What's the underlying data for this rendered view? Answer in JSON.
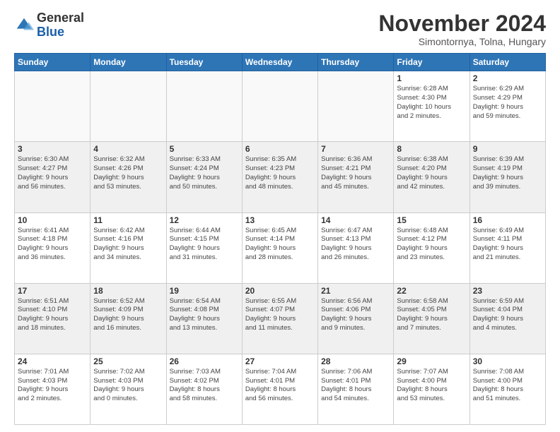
{
  "logo": {
    "general": "General",
    "blue": "Blue"
  },
  "header": {
    "month": "November 2024",
    "location": "Simontornya, Tolna, Hungary"
  },
  "weekdays": [
    "Sunday",
    "Monday",
    "Tuesday",
    "Wednesday",
    "Thursday",
    "Friday",
    "Saturday"
  ],
  "weeks": [
    [
      {
        "day": "",
        "info": ""
      },
      {
        "day": "",
        "info": ""
      },
      {
        "day": "",
        "info": ""
      },
      {
        "day": "",
        "info": ""
      },
      {
        "day": "",
        "info": ""
      },
      {
        "day": "1",
        "info": "Sunrise: 6:28 AM\nSunset: 4:30 PM\nDaylight: 10 hours\nand 2 minutes."
      },
      {
        "day": "2",
        "info": "Sunrise: 6:29 AM\nSunset: 4:29 PM\nDaylight: 9 hours\nand 59 minutes."
      }
    ],
    [
      {
        "day": "3",
        "info": "Sunrise: 6:30 AM\nSunset: 4:27 PM\nDaylight: 9 hours\nand 56 minutes."
      },
      {
        "day": "4",
        "info": "Sunrise: 6:32 AM\nSunset: 4:26 PM\nDaylight: 9 hours\nand 53 minutes."
      },
      {
        "day": "5",
        "info": "Sunrise: 6:33 AM\nSunset: 4:24 PM\nDaylight: 9 hours\nand 50 minutes."
      },
      {
        "day": "6",
        "info": "Sunrise: 6:35 AM\nSunset: 4:23 PM\nDaylight: 9 hours\nand 48 minutes."
      },
      {
        "day": "7",
        "info": "Sunrise: 6:36 AM\nSunset: 4:21 PM\nDaylight: 9 hours\nand 45 minutes."
      },
      {
        "day": "8",
        "info": "Sunrise: 6:38 AM\nSunset: 4:20 PM\nDaylight: 9 hours\nand 42 minutes."
      },
      {
        "day": "9",
        "info": "Sunrise: 6:39 AM\nSunset: 4:19 PM\nDaylight: 9 hours\nand 39 minutes."
      }
    ],
    [
      {
        "day": "10",
        "info": "Sunrise: 6:41 AM\nSunset: 4:18 PM\nDaylight: 9 hours\nand 36 minutes."
      },
      {
        "day": "11",
        "info": "Sunrise: 6:42 AM\nSunset: 4:16 PM\nDaylight: 9 hours\nand 34 minutes."
      },
      {
        "day": "12",
        "info": "Sunrise: 6:44 AM\nSunset: 4:15 PM\nDaylight: 9 hours\nand 31 minutes."
      },
      {
        "day": "13",
        "info": "Sunrise: 6:45 AM\nSunset: 4:14 PM\nDaylight: 9 hours\nand 28 minutes."
      },
      {
        "day": "14",
        "info": "Sunrise: 6:47 AM\nSunset: 4:13 PM\nDaylight: 9 hours\nand 26 minutes."
      },
      {
        "day": "15",
        "info": "Sunrise: 6:48 AM\nSunset: 4:12 PM\nDaylight: 9 hours\nand 23 minutes."
      },
      {
        "day": "16",
        "info": "Sunrise: 6:49 AM\nSunset: 4:11 PM\nDaylight: 9 hours\nand 21 minutes."
      }
    ],
    [
      {
        "day": "17",
        "info": "Sunrise: 6:51 AM\nSunset: 4:10 PM\nDaylight: 9 hours\nand 18 minutes."
      },
      {
        "day": "18",
        "info": "Sunrise: 6:52 AM\nSunset: 4:09 PM\nDaylight: 9 hours\nand 16 minutes."
      },
      {
        "day": "19",
        "info": "Sunrise: 6:54 AM\nSunset: 4:08 PM\nDaylight: 9 hours\nand 13 minutes."
      },
      {
        "day": "20",
        "info": "Sunrise: 6:55 AM\nSunset: 4:07 PM\nDaylight: 9 hours\nand 11 minutes."
      },
      {
        "day": "21",
        "info": "Sunrise: 6:56 AM\nSunset: 4:06 PM\nDaylight: 9 hours\nand 9 minutes."
      },
      {
        "day": "22",
        "info": "Sunrise: 6:58 AM\nSunset: 4:05 PM\nDaylight: 9 hours\nand 7 minutes."
      },
      {
        "day": "23",
        "info": "Sunrise: 6:59 AM\nSunset: 4:04 PM\nDaylight: 9 hours\nand 4 minutes."
      }
    ],
    [
      {
        "day": "24",
        "info": "Sunrise: 7:01 AM\nSunset: 4:03 PM\nDaylight: 9 hours\nand 2 minutes."
      },
      {
        "day": "25",
        "info": "Sunrise: 7:02 AM\nSunset: 4:03 PM\nDaylight: 9 hours\nand 0 minutes."
      },
      {
        "day": "26",
        "info": "Sunrise: 7:03 AM\nSunset: 4:02 PM\nDaylight: 8 hours\nand 58 minutes."
      },
      {
        "day": "27",
        "info": "Sunrise: 7:04 AM\nSunset: 4:01 PM\nDaylight: 8 hours\nand 56 minutes."
      },
      {
        "day": "28",
        "info": "Sunrise: 7:06 AM\nSunset: 4:01 PM\nDaylight: 8 hours\nand 54 minutes."
      },
      {
        "day": "29",
        "info": "Sunrise: 7:07 AM\nSunset: 4:00 PM\nDaylight: 8 hours\nand 53 minutes."
      },
      {
        "day": "30",
        "info": "Sunrise: 7:08 AM\nSunset: 4:00 PM\nDaylight: 8 hours\nand 51 minutes."
      }
    ]
  ]
}
